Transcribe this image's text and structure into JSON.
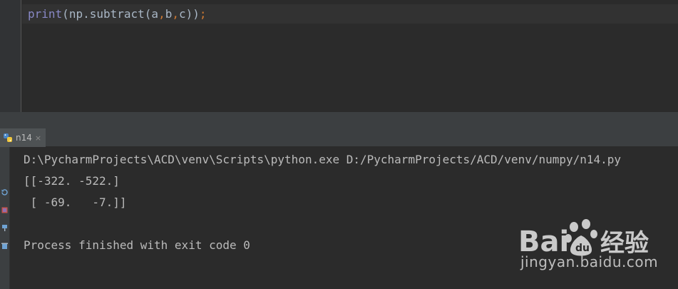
{
  "editor": {
    "code": {
      "fn": "print",
      "open": "(",
      "obj": "np",
      "dot": ".",
      "method": "subtract",
      "args_open": "(",
      "a": "a",
      "c1": ",",
      "b": "b",
      "c2": ",",
      "c": "c",
      "close": "))",
      "semi": ";"
    }
  },
  "run_panel": {
    "tab_label": "n14",
    "tab_close": "×"
  },
  "console": {
    "lines": [
      "D:\\PycharmProjects\\ACD\\venv\\Scripts\\python.exe D:/PycharmProjects/ACD/venv/numpy/n14.py",
      "[[-322. -522.]",
      " [ -69.   -7.]]",
      "",
      "Process finished with exit code 0"
    ]
  },
  "watermark": {
    "brand_text": "jingyan.baidu.com",
    "logo_text": "Bai 经验"
  },
  "colors": {
    "editor_bg": "#2b2b2b",
    "panel_bg": "#3c3f41",
    "builtin_fn": "#8888c6",
    "punctuation": "#cc7832",
    "text": "#a9b7c6",
    "console_text": "#bbbbbb"
  },
  "icons": {
    "tab": "python-icon",
    "strip": [
      "rerun-icon",
      "stop-icon",
      "pin-icon",
      "trash-icon"
    ]
  }
}
